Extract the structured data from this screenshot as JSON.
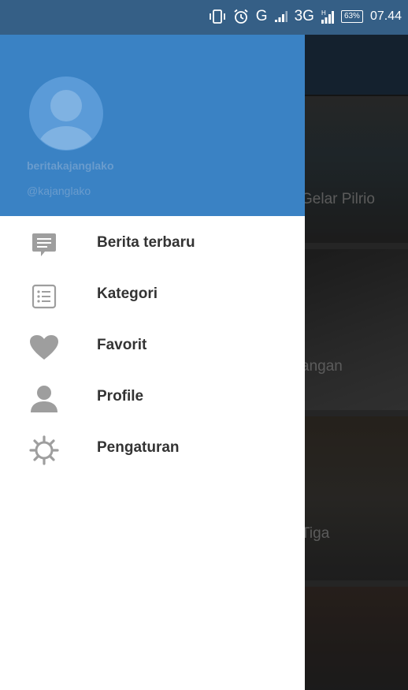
{
  "status_bar": {
    "network_g": "G",
    "network_3g": "3G",
    "battery": "63%",
    "time": "07.44"
  },
  "drawer": {
    "username": "beritakajanglako",
    "handle": "@kajanglako",
    "menu": [
      {
        "label": "Berita terbaru",
        "icon": "chat-bubble-icon"
      },
      {
        "label": "Kategori",
        "icon": "list-icon"
      },
      {
        "label": "Favorit",
        "icon": "heart-icon"
      },
      {
        "label": "Profile",
        "icon": "person-icon"
      },
      {
        "label": "Pengaturan",
        "icon": "gear-icon"
      }
    ]
  },
  "background_feed": {
    "captions": [
      "Gelar Pilrio",
      "angan",
      "Tiga"
    ]
  },
  "colors": {
    "status_bar": "#355f86",
    "drawer_header": "#3a82c4",
    "icon_gray": "#9e9e9e",
    "menu_text": "#333333"
  }
}
